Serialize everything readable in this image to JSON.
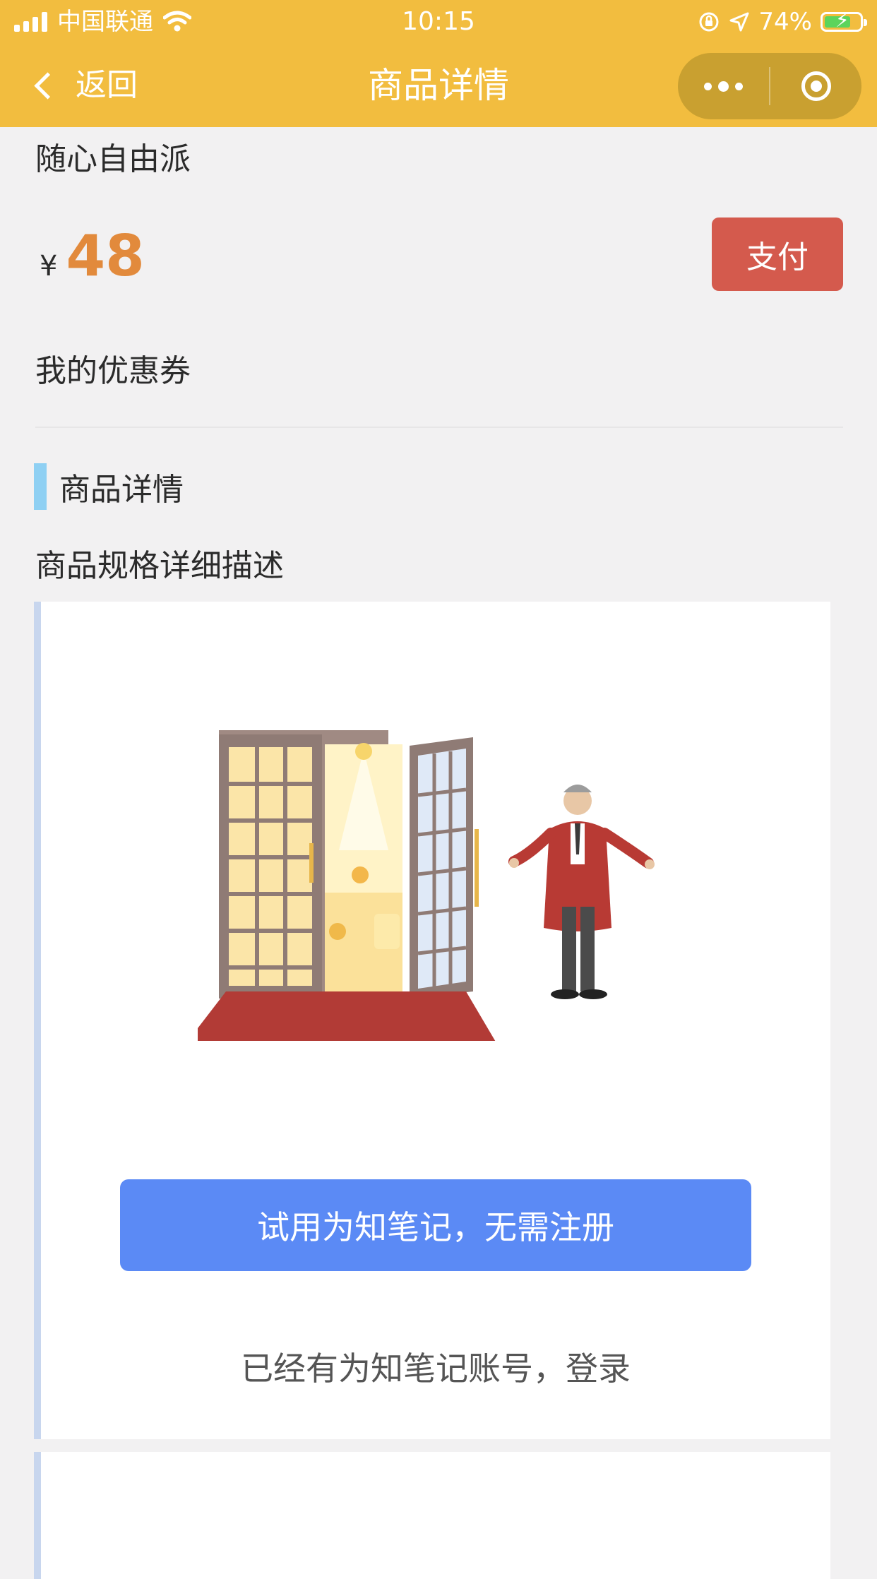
{
  "status_bar": {
    "carrier": "中国联通",
    "time": "10:15",
    "battery": "74%",
    "battery_level": 0.74,
    "icons": [
      "signal-icon",
      "wifi-icon",
      "orientation-lock-icon",
      "location-icon",
      "battery-icon"
    ]
  },
  "nav": {
    "back_label": "返回",
    "title": "商品详情",
    "icons": [
      "back-chevron-icon",
      "more-icon",
      "close-target-icon"
    ]
  },
  "product": {
    "name": "随心自由派",
    "currency": "¥",
    "price": "48",
    "pay_label": "支付"
  },
  "coupon": {
    "label": "我的优惠券"
  },
  "detail": {
    "section_title": "商品详情",
    "description": "商品规格详细描述",
    "cta_label": "试用为知笔记，无需注册",
    "login_label": "已经有为知笔记账号，登录"
  },
  "colors": {
    "brand": "#f2bd3f",
    "price": "#e28a3c",
    "pay": "#d45a4d",
    "cta": "#5b8af5",
    "section_bar": "#8fd0f3"
  }
}
